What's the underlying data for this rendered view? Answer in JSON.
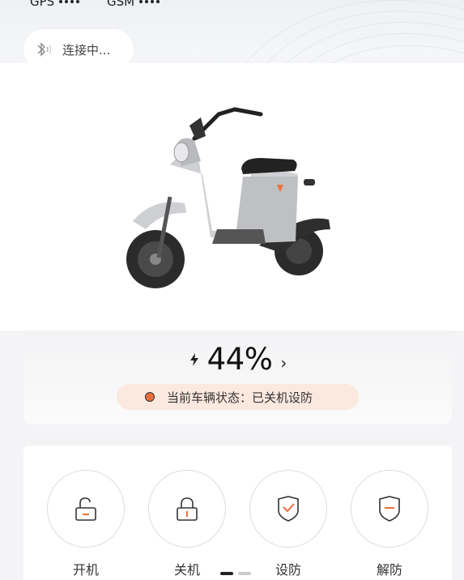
{
  "status_bar": {
    "gps_label": "GPS",
    "gsm_label": "GSM"
  },
  "connection": {
    "text": "连接中..."
  },
  "battery": {
    "value": "44%",
    "level": 0.44
  },
  "vehicle_status": {
    "text": "当前车辆状态：已关机设防"
  },
  "actions": [
    {
      "label": "开机",
      "icon": "unlock-icon"
    },
    {
      "label": "关机",
      "icon": "lock-icon"
    },
    {
      "label": "设防",
      "icon": "shield-check-icon"
    },
    {
      "label": "解防",
      "icon": "shield-off-icon"
    }
  ],
  "pager": {
    "pages": 2,
    "active": 0
  },
  "colors": {
    "accent": "#ea6f3c",
    "pill_bg": "#fbe8de"
  }
}
